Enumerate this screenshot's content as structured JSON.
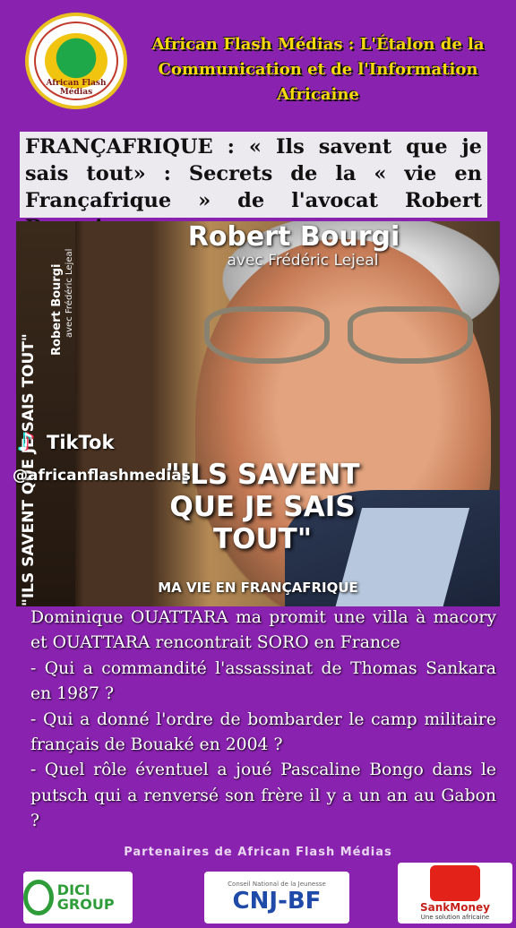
{
  "header": {
    "logo_label": "African Flash Médias",
    "slogan_line1": "African Flash Médias : L'Étalon de la",
    "slogan_line2": "Communication et de l'Information Africaine"
  },
  "headline": "FRANÇAFRIQUE : « Ils savent que je sais tout» : Secrets de la « vie en Françafrique » de l'avocat Robert Bourgi",
  "book": {
    "author": "Robert Bourgi",
    "coauthor": "avec Frédéric Lejeal",
    "title": "\"ILS SAVENT\nQUE JE SAIS\nTOUT\"",
    "subtitle": "MA VIE EN FRANÇAFRIQUE",
    "spine_title": "\"ILS SAVENT QUE JE SAIS TOUT\"",
    "spine_author": "Robert Bourgi",
    "spine_coauthor": "avec Frédéric Lejeal"
  },
  "watermark": {
    "app": "TikTok",
    "handle": "@africanflashmedias"
  },
  "body": {
    "line1": "Dominique OUATTARA ma promit une villa à macory et OUATTARA rencontrait SORO en France",
    "line2": "- Qui a commandité l'assassinat de Thomas Sankara en 1987 ?",
    "line3": "- Qui a donné l'ordre de bombarder le camp militaire français de Bouaké en 2004 ?",
    "line4": "- Quel rôle éventuel a joué Pascaline Bongo dans le putsch qui a renversé son frère il y a un an au Gabon ?"
  },
  "partners": {
    "title": "Partenaires de African Flash Médias",
    "p1": "DICI GROUP",
    "p2_small": "Conseil National de la Jeunesse",
    "p2_main": "CNJ",
    "p2_suffix": "-BF",
    "p3_name": "SankMoney",
    "p3_tagline": "Une solution africaine"
  },
  "colors": {
    "background": "#8a22b0",
    "slogan": "#f5d90a",
    "headline_bg": "#ece9ef"
  }
}
